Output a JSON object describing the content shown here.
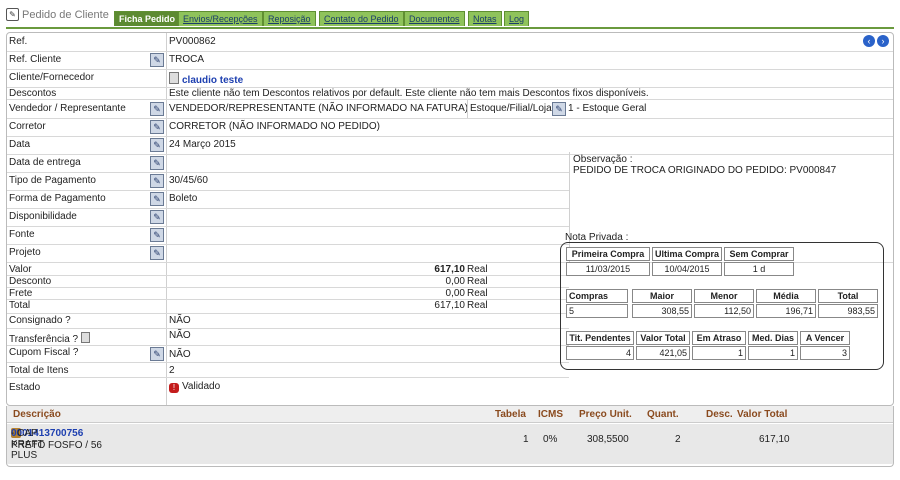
{
  "tabs": {
    "title": "Pedido de Cliente",
    "items": [
      "Ficha Pedido",
      "Envios/Recepções",
      "Reposição",
      "Contato do Pedido",
      "Documentos",
      "Notas",
      "Log"
    ]
  },
  "fields": {
    "ref_label": "Ref.",
    "ref": "PV000862",
    "ref_cliente_label": "Ref. Cliente",
    "ref_cliente": "TROCA",
    "cliente_label": "Cliente/Fornecedor",
    "cliente": "claudio teste",
    "descontos_label": "Descontos",
    "descontos": "Este cliente não tem Descontos relativos por default. Este cliente não tem mais Descontos fixos disponíveis.",
    "vendedor_label": "Vendedor / Representante",
    "vendedor": "VENDEDOR/REPRESENTANTE (NÃO INFORMADO NA FATURA)",
    "estoque_label": "Estoque/Filial/Loja",
    "estoque": "1 - Estoque Geral",
    "corretor_label": "Corretor",
    "corretor": "CORRETOR (NÃO INFORMADO NO PEDIDO)",
    "data_label": "Data",
    "data": "24 Março 2015",
    "entrega_label": "Data de entrega",
    "pagamento_label": "Tipo de Pagamento",
    "pagamento": "30/45/60",
    "forma_label": "Forma de Pagamento",
    "forma": "Boleto",
    "disponibilidade_label": "Disponibilidade",
    "fonte_label": "Fonte",
    "projeto_label": "Projeto",
    "observacao_label": "Observação :",
    "observacao": "PEDIDO DE TROCA ORIGINADO DO PEDIDO: PV000847"
  },
  "values": {
    "valor_label": "Valor",
    "valor": "617,10",
    "desconto_label": "Desconto",
    "desconto": "0,00",
    "frete_label": "Frete",
    "frete": "0,00",
    "total_label": "Total",
    "total": "617,10",
    "currency": "Real",
    "consignado_label": "Consignado ?",
    "consignado": "NÃO",
    "transferencia_label": "Transferência ?",
    "transferencia": "NÃO",
    "cupom_label": "Cupom Fiscal ?",
    "cupom": "NÃO",
    "total_itens_label": "Total de Itens",
    "total_itens": "2",
    "estado_label": "Estado",
    "estado": "Validado"
  },
  "private_note": {
    "label": "Nota Privada :",
    "t1_headers": [
      "Primeira Compra",
      "Ultima Compra",
      "Sem Comprar"
    ],
    "t1_values": [
      "11/03/2015",
      "10/04/2015",
      "1 d"
    ],
    "t2_headers": [
      "Compras",
      "Maior",
      "Menor",
      "Média",
      "Total"
    ],
    "t2_values": [
      "5",
      "308,55",
      "112,50",
      "196,71",
      "983,55"
    ],
    "t3_headers": [
      "Tit. Pendentes",
      "Valor Total",
      "Em Atraso",
      "Med. Dias",
      "A Vencer"
    ],
    "t3_values": [
      "4",
      "421,05",
      "1",
      "1",
      "3"
    ]
  },
  "items": {
    "headers": [
      "Descrição",
      "Tabela",
      "ICMS",
      "Preço Unit.",
      "Quant.",
      "Desc.",
      "Valor Total"
    ],
    "row": {
      "code": "0001413700756",
      "name": " - CAP KRAFT PLUS",
      "sub": "PRETO FOSFO / 56",
      "tabela": "1",
      "icms": "0%",
      "preco": "308,5500",
      "quant": "2",
      "desc": "",
      "total": "617,10"
    }
  }
}
